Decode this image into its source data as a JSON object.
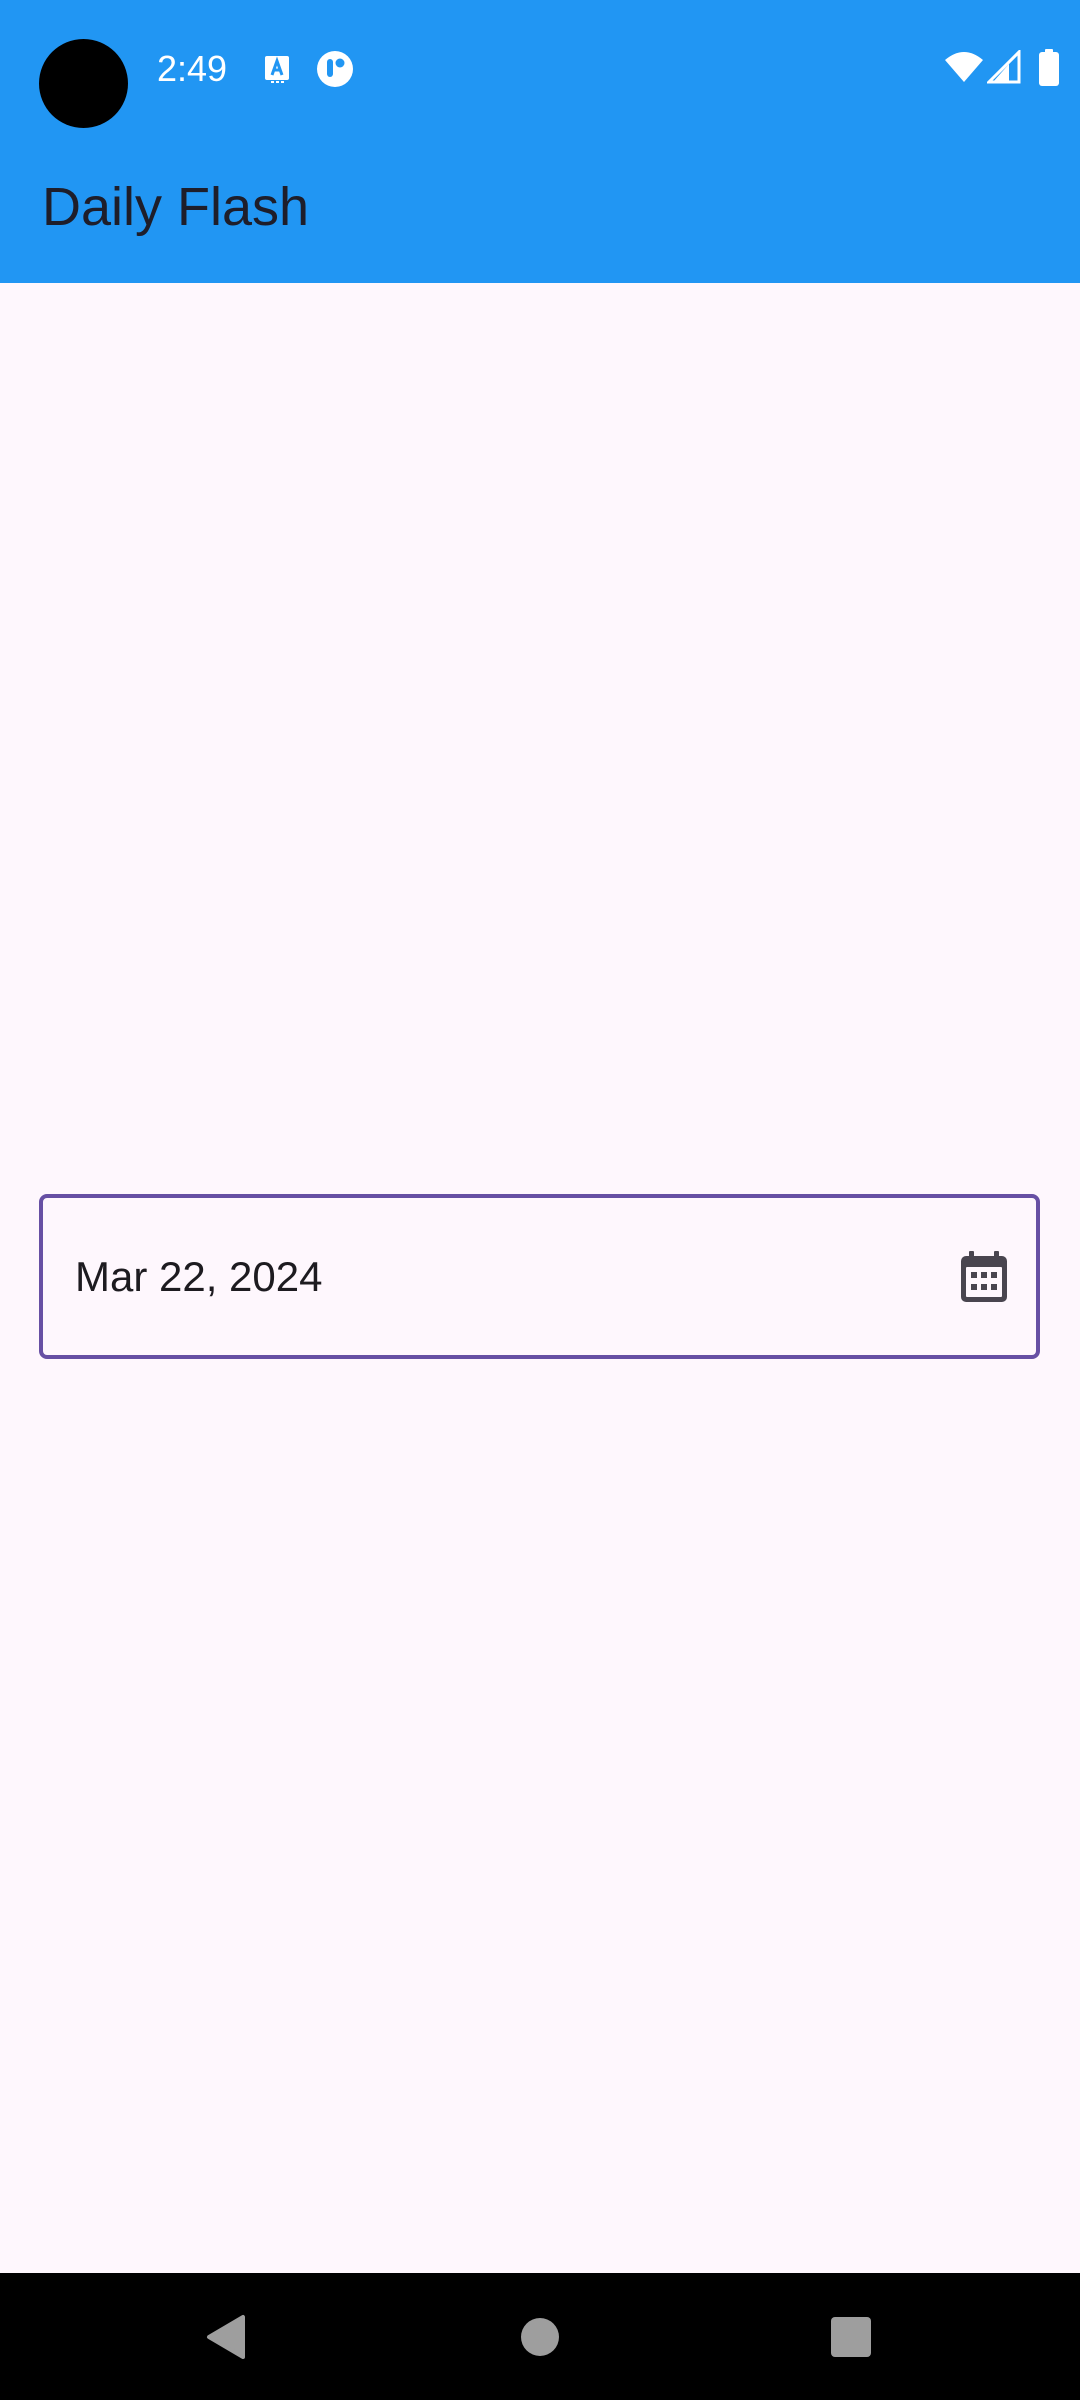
{
  "status_bar": {
    "time": "2:49",
    "icons": [
      "text-a-icon",
      "notification-app-icon",
      "wifi-icon",
      "cell-signal-icon",
      "battery-icon"
    ]
  },
  "app_bar": {
    "title": "Daily Flash"
  },
  "date_field": {
    "value": "Mar 22, 2024",
    "trailing_icon": "calendar-icon"
  },
  "nav_bar": {
    "buttons": [
      "back-icon",
      "home-icon",
      "recents-icon"
    ]
  },
  "colors": {
    "app_bar": "#2196F3",
    "background": "#FEF7FD",
    "field_border": "#6750A4",
    "text": "#1D1B20",
    "nav_bar": "#000000"
  }
}
